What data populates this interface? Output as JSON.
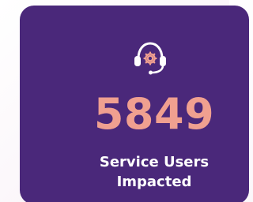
{
  "stat": {
    "value": "5849",
    "label": "Service Users\nImpacted"
  },
  "icon": "support-headset-gear-icon",
  "colors": {
    "card": "#4a287a",
    "accent": "#f0a090",
    "text": "#ffffff"
  }
}
